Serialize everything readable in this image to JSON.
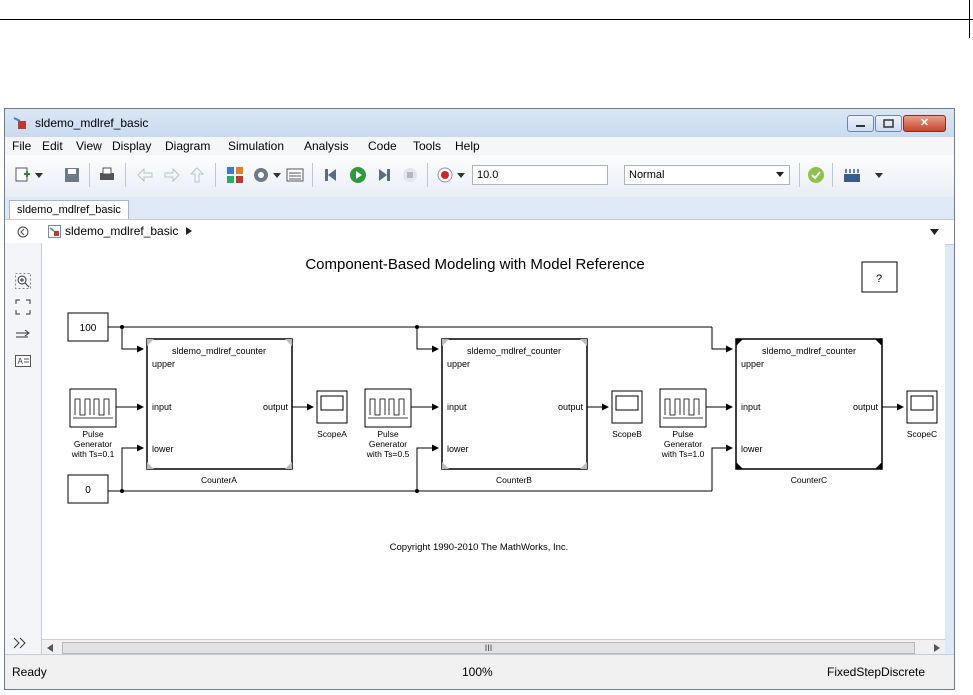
{
  "window": {
    "title": "sldemo_mdlref_basic"
  },
  "menu": [
    "File",
    "Edit",
    "View",
    "Display",
    "Diagram",
    "Simulation",
    "Analysis",
    "Code",
    "Tools",
    "Help"
  ],
  "toolbar": {
    "stop_time": "10.0",
    "sim_mode": "Normal"
  },
  "tab": {
    "label": "sldemo_mdlref_basic"
  },
  "breadcrumb": {
    "model": "sldemo_mdlref_basic"
  },
  "diagram": {
    "title": "Component-Based Modeling with Model Reference",
    "help_label": "?",
    "const_upper": "100",
    "const_lower": "0",
    "model_ref_name": "sldemo_mdlref_counter",
    "port_upper": "upper",
    "port_input": "input",
    "port_lower": "lower",
    "port_output": "output",
    "pulse_a": [
      "Pulse",
      "Generator",
      "with Ts=0.1"
    ],
    "pulse_b": [
      "Pulse",
      "Generator",
      "with Ts=0.5"
    ],
    "pulse_c": [
      "Pulse",
      "Generator",
      "with Ts=1.0"
    ],
    "counter_a": "CounterA",
    "counter_b": "CounterB",
    "counter_c": "CounterC",
    "scope_a": "ScopeA",
    "scope_b": "ScopeB",
    "scope_c": "ScopeC",
    "copyright": "Copyright 1990-2010 The MathWorks, Inc."
  },
  "scrollbar": {
    "thumb": "III"
  },
  "status": {
    "left": "Ready",
    "zoom": "100%",
    "solver": "FixedStepDiscrete"
  }
}
